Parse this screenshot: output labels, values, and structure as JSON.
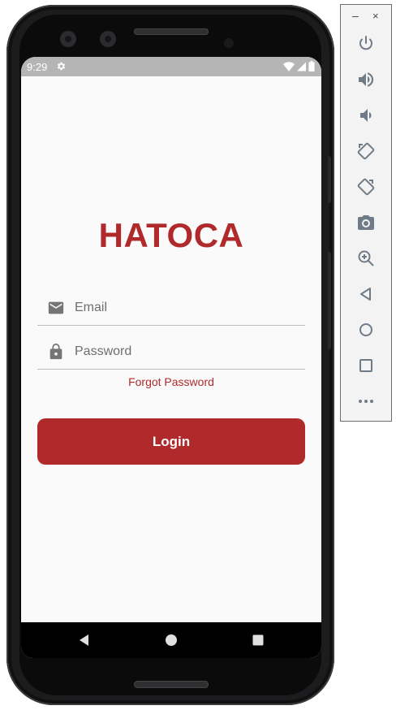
{
  "status_bar": {
    "time": "9:29"
  },
  "app": {
    "title": "HATOCA",
    "email_placeholder": "Email",
    "password_placeholder": "Password",
    "forgot_password": "Forgot Password",
    "login_label": "Login",
    "accent_color": "#b0292b"
  },
  "emulator_toolbar": {
    "minimize": "–",
    "close": "×",
    "buttons": [
      "power-icon",
      "volume-up-icon",
      "volume-down-icon",
      "rotate-left-icon",
      "rotate-right-icon",
      "screenshot-icon",
      "zoom-icon",
      "back-icon",
      "home-icon",
      "overview-icon",
      "more-icon"
    ]
  },
  "nav_bar": {
    "buttons": [
      "back-icon",
      "home-icon",
      "recents-icon"
    ]
  }
}
